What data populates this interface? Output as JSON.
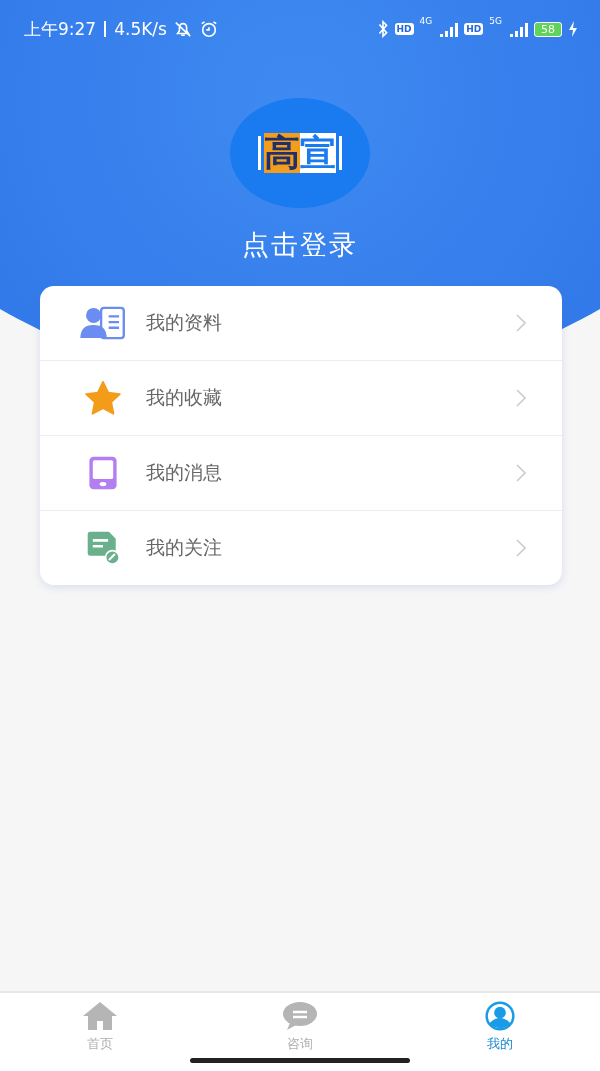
{
  "status_bar": {
    "time": "上午9:27",
    "speed": "4.5K/s",
    "sim1_badge": "HD",
    "sim1_network": "4G",
    "sim2_badge": "HD",
    "sim2_network": "5G",
    "battery": "58"
  },
  "profile": {
    "logo_left": "高",
    "logo_right": "宣",
    "login": "点击登录"
  },
  "menu": [
    {
      "kind": "profile",
      "label": "我的资料"
    },
    {
      "kind": "star",
      "label": "我的收藏"
    },
    {
      "kind": "phone",
      "label": "我的消息"
    },
    {
      "kind": "note",
      "label": "我的关注"
    }
  ],
  "tabs": [
    {
      "kind": "home",
      "label": "首页",
      "selected": false
    },
    {
      "kind": "chat",
      "label": "咨询",
      "selected": false
    },
    {
      "kind": "user",
      "label": "我的",
      "selected": true
    }
  ]
}
